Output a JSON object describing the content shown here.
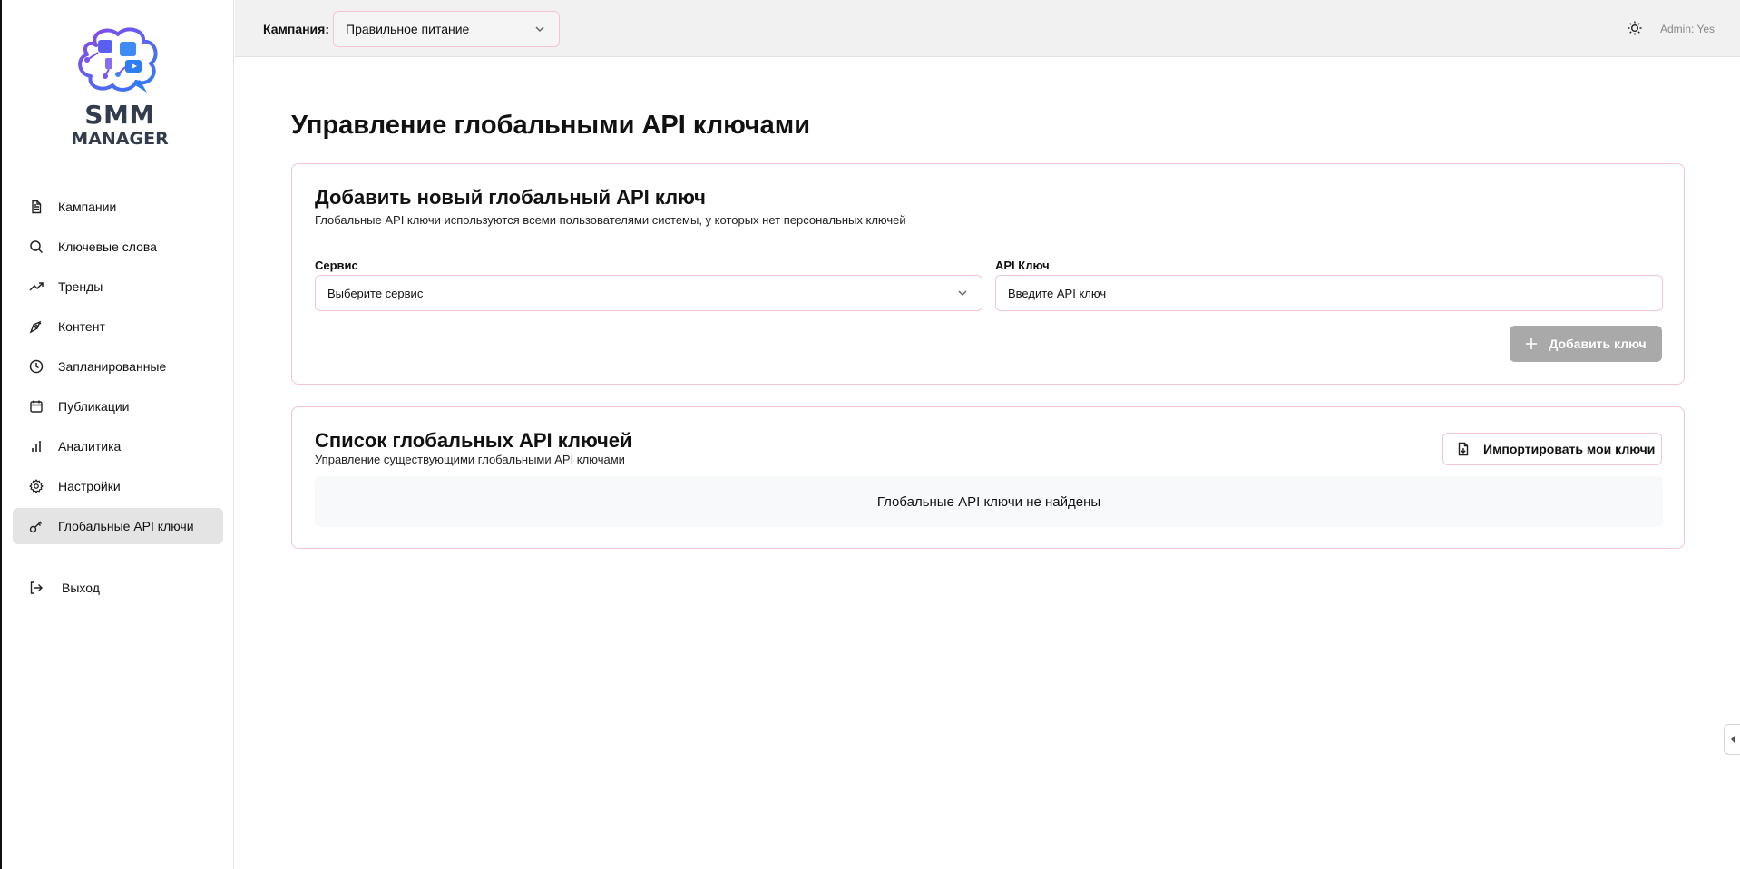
{
  "brand": {
    "line1": "SMM",
    "line2": "MANAGER",
    "colors": {
      "accent_purple": "#7a53f0",
      "accent_blue": "#2f7df6",
      "text": "#333c4d"
    }
  },
  "sidebar": {
    "items": [
      {
        "label": "Кампании",
        "icon": "file-text-icon"
      },
      {
        "label": "Ключевые слова",
        "icon": "search-icon"
      },
      {
        "label": "Тренды",
        "icon": "trending-up-icon"
      },
      {
        "label": "Контент",
        "icon": "pen-tool-icon"
      },
      {
        "label": "Запланированные",
        "icon": "clock-icon"
      },
      {
        "label": "Публикации",
        "icon": "calendar-icon"
      },
      {
        "label": "Аналитика",
        "icon": "bar-chart-icon"
      },
      {
        "label": "Настройки",
        "icon": "gear-icon"
      },
      {
        "label": "Глобальные API ключи",
        "icon": "key-icon",
        "active": true
      }
    ],
    "logout_label": "Выход"
  },
  "header": {
    "campaign_label": "Кампания:",
    "campaign_value": "Правильное питание",
    "admin_label": "Admin: Yes"
  },
  "main": {
    "page_title": "Управление глобальными API ключами",
    "add_card": {
      "title": "Добавить новый глобальный API ключ",
      "subtitle": "Глобальные API ключи используются всеми пользователями системы, у которых нет персональных ключей",
      "service_label": "Сервис",
      "service_placeholder": "Выберите сервис",
      "key_label": "API Ключ",
      "key_placeholder": "Введите API ключ",
      "add_button": "Добавить ключ"
    },
    "list_card": {
      "title": "Список глобальных API ключей",
      "subtitle": "Управление существующими глобальными API ключами",
      "import_button": "Импортировать мои ключи",
      "empty_text": "Глобальные API ключи не найдены"
    }
  },
  "colors": {
    "border_pink": "#f2c6d1",
    "button_disabled": "#a9a9a9",
    "active_nav_bg": "#e4e4e4"
  }
}
